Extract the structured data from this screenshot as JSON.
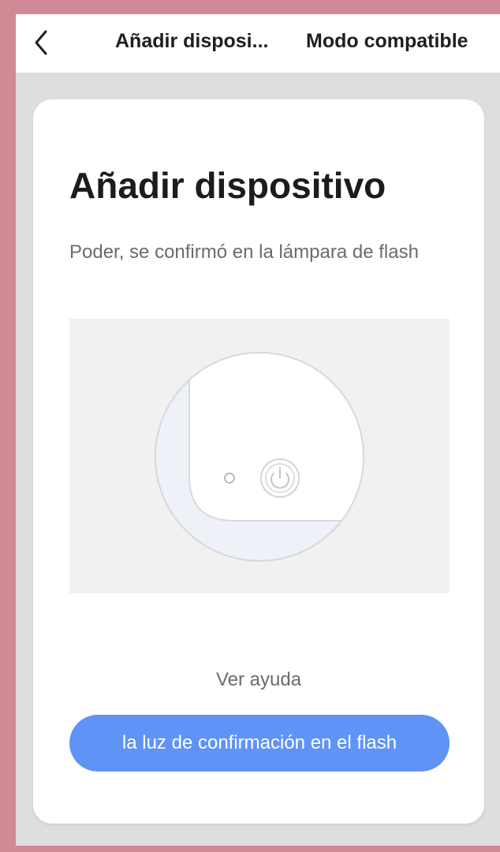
{
  "topbar": {
    "back_icon": "chevron-left-icon",
    "title": "Añadir disposi...",
    "mode_label": "Modo compatible"
  },
  "card": {
    "title": "Añadir dispositivo",
    "description": "Poder, se confirmó en la lámpara de flash",
    "illustration_icon": "power-icon",
    "help_label": "Ver ayuda",
    "confirm_label": "la luz de confirmación en el flash"
  },
  "colors": {
    "frame_border": "#d08a96",
    "screen_background": "#dedede",
    "card_background": "#ffffff",
    "primary_button": "#5f93f5",
    "text_primary": "#1c1c1e",
    "text_secondary": "#6b6b6b"
  }
}
